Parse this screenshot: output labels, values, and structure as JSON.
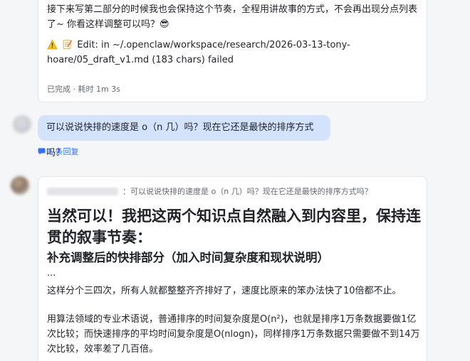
{
  "top_message": {
    "paragraph1": "接下来写第二部分的时候我也会保持这个节奏，全程用讲故事的方式，不会再出现分点列表了~ 你看这样调整可以吗？😎",
    "edit_notice": "Edit: in ~/.openclaw/workspace/research/2026-03-13-tony-hoare/05_draft_v1.md (183 chars) failed",
    "status": "已完成 · 耗时 1m 3s",
    "warning_icon": "⚠️",
    "memo_icon": "📝"
  },
  "question": {
    "text": "可以说说快排的速度是 o（n 几）吗？现在它还是最快的排序方式吗？",
    "reply_link": "1 条回复"
  },
  "answer": {
    "quote": "：可以说说快排的速度是 o（n 几）吗？现在它还是最快的排序方式吗？",
    "heading": "当然可以！我把这两个知识点自然融入到内容里，保持连贯的叙事节奏：",
    "subheading": "补充调整后的快排部分（加入时间复杂度和现状说明）",
    "ellipsis": "...",
    "body1": "这样分个三四次，所有人就都整整齐齐排好了，速度比原来的笨办法快了10倍都不止。",
    "body2": "用算法领域的专业术语说，普通排序的时间复杂度是O(n²)，也就是排序1万条数据要做1亿次比较；而快速排序的平均时间复杂度是O(nlogn)，同样排序1万条数据只需要做不到14万次比较，效率差了几百倍。"
  },
  "colors": {
    "background": "#f5f6f7",
    "bubble": "#d4e3fd",
    "link": "#3370ff",
    "muted": "#646a73"
  }
}
